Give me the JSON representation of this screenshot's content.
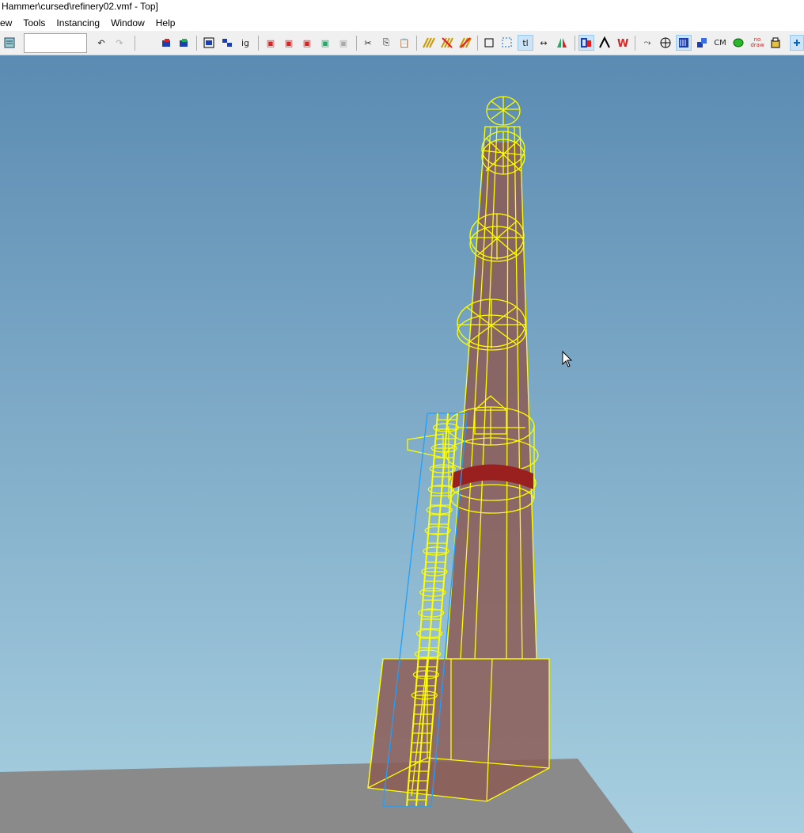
{
  "window": {
    "title": "Hammer\\cursed\\refinery02.vmf - Top]"
  },
  "menu": {
    "items": [
      "ew",
      "Tools",
      "Instancing",
      "Window",
      "Help"
    ]
  },
  "toolbar": {
    "label_tl": "tl",
    "label_ig": "ig",
    "label_cm": "CM",
    "label_nodraw": "no draw"
  },
  "viewport": {
    "colors": {
      "sky_top": "#5b8bb2",
      "sky_bottom": "#a7cfe0",
      "ground": "#8a8a8a",
      "wireframe": "#ffff00",
      "brick": "#8c5a55",
      "ladder_outline": "#1ea0ff"
    }
  }
}
